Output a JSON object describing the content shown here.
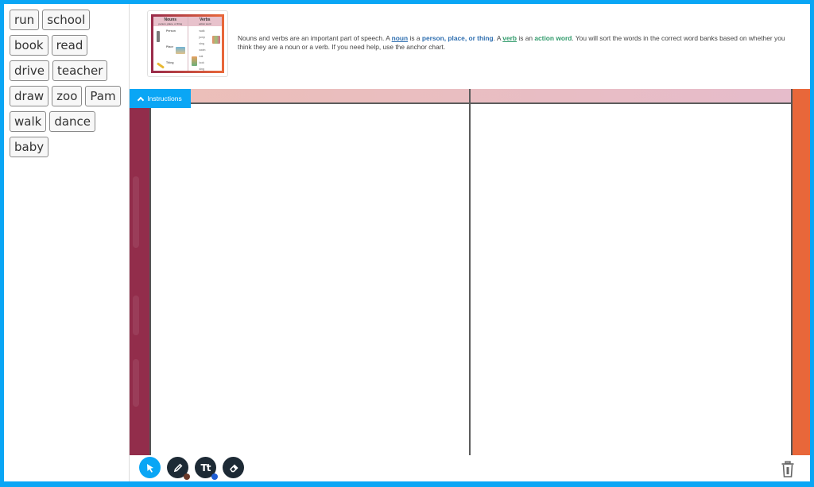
{
  "word_bank": {
    "rows": [
      [
        "run",
        "school"
      ],
      [
        "book",
        "read"
      ],
      [
        "drive",
        "teacher"
      ],
      [
        "draw",
        "zoo",
        "Pam"
      ],
      [
        "walk",
        "dance"
      ],
      [
        "baby"
      ]
    ]
  },
  "header": {
    "anchor_chart": {
      "nouns_title": "Nouns",
      "nouns_subtitle": "person, place, or thing",
      "verbs_title": "Verbs",
      "verbs_subtitle": "action word",
      "noun_groups": [
        "Person",
        "Place",
        "Thing"
      ],
      "verb_words": [
        "walk",
        "jump",
        "sing",
        "swim",
        "eat",
        "look",
        "sing"
      ]
    },
    "description": {
      "part1": "Nouns and verbs are an important part of speech. A ",
      "noun_link": "noun",
      "part2": " is a ",
      "noun_definition": "person, place, or thing",
      "part3": ". A ",
      "verb_link": "verb",
      "part4": " is an ",
      "verb_definition": "action word",
      "part5": ". You will sort the words in the correct word banks based on whether you think they are a noun or a verb. If you need help, use the anchor chart."
    }
  },
  "board": {
    "instructions_label": "Instructions",
    "colors": {
      "left_band": "#922d4b",
      "right_band": "#e8673a",
      "top_band": "#ecbfb8",
      "accent": "#0aa6f5"
    }
  },
  "toolbar": {
    "tools": [
      {
        "name": "select",
        "icon": "cursor-arrow-icon",
        "active": true
      },
      {
        "name": "pen",
        "icon": "pencil-icon",
        "color_dot": "#6b3a2a"
      },
      {
        "name": "text",
        "icon": "text-icon",
        "label": "Tt",
        "color_dot": "#1f5fd6"
      },
      {
        "name": "eraser",
        "icon": "eraser-icon"
      }
    ],
    "trash_icon": "trash-icon"
  }
}
